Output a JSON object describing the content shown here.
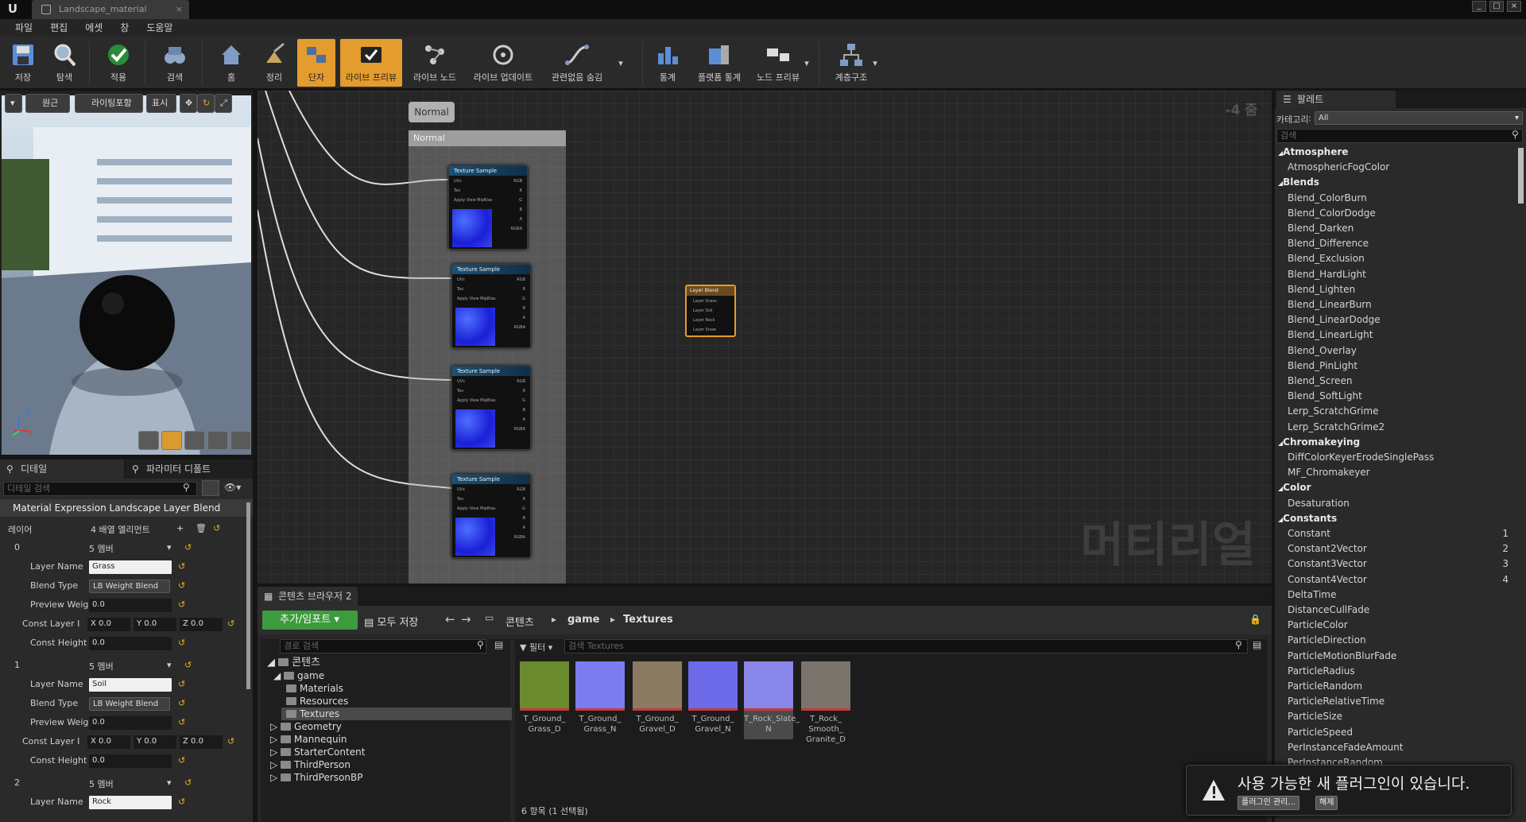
{
  "window": {
    "tab_title": "Landscape_material"
  },
  "menu": [
    "파일",
    "편집",
    "에셋",
    "창",
    "도움말"
  ],
  "toolbar": {
    "save": "저장",
    "browse": "탐색",
    "apply": "적용",
    "search": "검색",
    "home": "홈",
    "clean": "정리",
    "hide": "단자",
    "live_preview": "라이브 프리뷰",
    "live_nodes": "라이브 노드",
    "live_update": "라이브 업데이트",
    "hide_unrelated": "관련없음 숨김",
    "stats": "통계",
    "platform_stats": "플랫폼 통계",
    "node_preview": "노드 프리뷰",
    "hierarchy": "계층구조"
  },
  "viewport": {
    "perspective": "원근",
    "lit": "라이팅포함",
    "show": "표시",
    "axis_z": "Z",
    "axis_x": "X"
  },
  "details": {
    "tab_details": "디테일",
    "tab_params": "파라미터 디폴트",
    "search_placeholder": "디테일 검색",
    "section": "Material Expression Landscape Layer Blend",
    "layers_label": "레이어",
    "layers_value": "4 배열 엘리먼트",
    "layers": [
      {
        "index": "0",
        "members": "5 멤버",
        "name": "Grass",
        "blend": "LB Weight Blend",
        "preview": "0.0",
        "x": "0.0",
        "y": "0.0",
        "z": "0.0",
        "height": "0.0"
      },
      {
        "index": "1",
        "members": "5 멤버",
        "name": "Soil",
        "blend": "LB Weight Blend",
        "preview": "0.0",
        "x": "0.0",
        "y": "0.0",
        "z": "0.0",
        "height": "0.0"
      },
      {
        "index": "2",
        "members": "5 멤버",
        "name": "Rock"
      }
    ],
    "lbl_name": "Layer Name",
    "lbl_blend": "Blend Type",
    "lbl_preview": "Preview Weig",
    "lbl_const": "Const Layer I",
    "lbl_height": "Const Height",
    "lx": "X",
    "ly": "Y",
    "lz": "Z"
  },
  "graph": {
    "zoom": "-4 줌",
    "watermark": "머티리얼",
    "comment_title": "Normal",
    "comment_header": "Normal",
    "node_title": "Texture Sample",
    "pins_in": [
      "UVs",
      "Tex",
      "Apply View MipBias"
    ],
    "pins_out": [
      "RGB",
      "R",
      "G",
      "B",
      "A",
      "RGBA"
    ],
    "blend_title": "Layer Blend",
    "blend_pins": [
      "Layer Grass",
      "Layer Soil",
      "Layer Rock",
      "Layer Snow"
    ]
  },
  "content_browser": {
    "tab": "콘텐츠 브라우저 2",
    "add_import": "추가/임포트",
    "save_all": "모두 저장",
    "path": [
      "콘텐츠",
      "game",
      "Textures"
    ],
    "path_search": "경로 검색",
    "filter": "필터",
    "asset_search": "검색 Textures",
    "tree": [
      {
        "label": "콘텐츠",
        "level": 0
      },
      {
        "label": "game",
        "level": 1
      },
      {
        "label": "Materials",
        "level": 2
      },
      {
        "label": "Resources",
        "level": 2
      },
      {
        "label": "Textures",
        "level": 2
      },
      {
        "label": "Geometry",
        "level": 1
      },
      {
        "label": "Mannequin",
        "level": 1
      },
      {
        "label": "StarterContent",
        "level": 1
      },
      {
        "label": "ThirdPerson",
        "level": 1
      },
      {
        "label": "ThirdPersonBP",
        "level": 1
      }
    ],
    "assets": [
      {
        "name": "T_Ground_ Grass_D",
        "color": "#6b8a2e"
      },
      {
        "name": "T_Ground_ Grass_N",
        "color": "#7a7cf0"
      },
      {
        "name": "T_Ground_ Gravel_D",
        "color": "#8a7a62"
      },
      {
        "name": "T_Ground_ Gravel_N",
        "color": "#6c6ae8"
      },
      {
        "name": "T_Rock_Slate_ N",
        "color": "#8886e8"
      },
      {
        "name": "T_Rock_ Smooth_ Granite_D",
        "color": "#7a746c"
      }
    ],
    "status": "6 항목 (1 선택됨)"
  },
  "palette": {
    "tab": "팔레트",
    "category_label": "카테고리",
    "category_value": "All",
    "search_placeholder": "검색",
    "items": [
      {
        "t": "c",
        "label": "Atmosphere"
      },
      {
        "t": "i",
        "label": "AtmosphericFogColor"
      },
      {
        "t": "c",
        "label": "Blends"
      },
      {
        "t": "i",
        "label": "Blend_ColorBurn"
      },
      {
        "t": "i",
        "label": "Blend_ColorDodge"
      },
      {
        "t": "i",
        "label": "Blend_Darken"
      },
      {
        "t": "i",
        "label": "Blend_Difference"
      },
      {
        "t": "i",
        "label": "Blend_Exclusion"
      },
      {
        "t": "i",
        "label": "Blend_HardLight"
      },
      {
        "t": "i",
        "label": "Blend_Lighten"
      },
      {
        "t": "i",
        "label": "Blend_LinearBurn"
      },
      {
        "t": "i",
        "label": "Blend_LinearDodge"
      },
      {
        "t": "i",
        "label": "Blend_LinearLight"
      },
      {
        "t": "i",
        "label": "Blend_Overlay"
      },
      {
        "t": "i",
        "label": "Blend_PinLight"
      },
      {
        "t": "i",
        "label": "Blend_Screen"
      },
      {
        "t": "i",
        "label": "Blend_SoftLight"
      },
      {
        "t": "i",
        "label": "Lerp_ScratchGrime"
      },
      {
        "t": "i",
        "label": "Lerp_ScratchGrime2"
      },
      {
        "t": "c",
        "label": "Chromakeying"
      },
      {
        "t": "i",
        "label": "DiffColorKeyerErodeSinglePass"
      },
      {
        "t": "i",
        "label": "MF_Chromakeyer"
      },
      {
        "t": "c",
        "label": "Color"
      },
      {
        "t": "i",
        "label": "Desaturation"
      },
      {
        "t": "c",
        "label": "Constants"
      },
      {
        "t": "i",
        "label": "Constant",
        "n": "1"
      },
      {
        "t": "i",
        "label": "Constant2Vector",
        "n": "2"
      },
      {
        "t": "i",
        "label": "Constant3Vector",
        "n": "3"
      },
      {
        "t": "i",
        "label": "Constant4Vector",
        "n": "4"
      },
      {
        "t": "i",
        "label": "DeltaTime"
      },
      {
        "t": "i",
        "label": "DistanceCullFade"
      },
      {
        "t": "i",
        "label": "ParticleColor"
      },
      {
        "t": "i",
        "label": "ParticleDirection"
      },
      {
        "t": "i",
        "label": "ParticleMotionBlurFade"
      },
      {
        "t": "i",
        "label": "ParticleRadius"
      },
      {
        "t": "i",
        "label": "ParticleRandom"
      },
      {
        "t": "i",
        "label": "ParticleRelativeTime"
      },
      {
        "t": "i",
        "label": "ParticleSize"
      },
      {
        "t": "i",
        "label": "ParticleSpeed"
      },
      {
        "t": "i",
        "label": "PerInstanceFadeAmount"
      },
      {
        "t": "i",
        "label": "PerInstanceRandom"
      }
    ]
  },
  "notification": {
    "message": "사용 가능한 새 플러그인이 있습니다.",
    "manage": "플러그인 관리...",
    "dismiss": "해제"
  }
}
